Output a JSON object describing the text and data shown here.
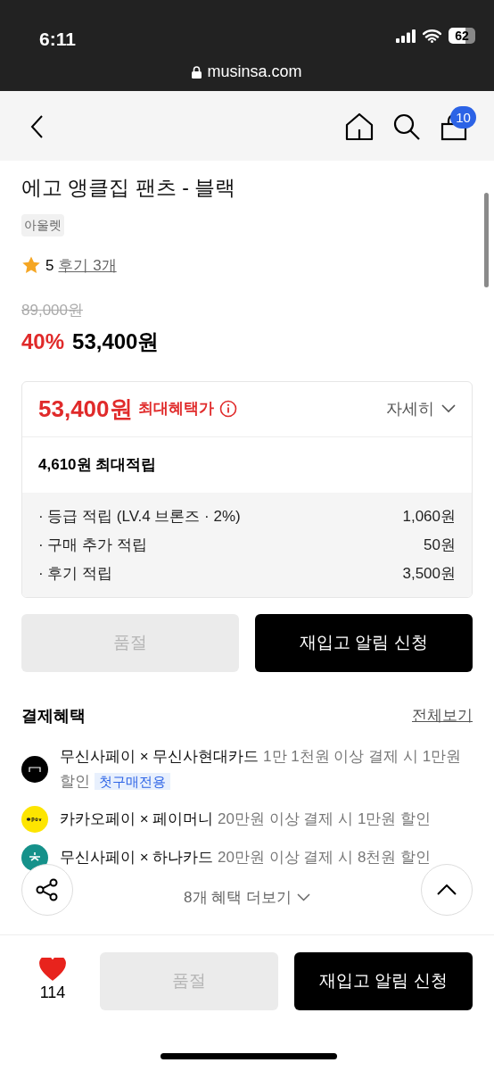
{
  "status_bar": {
    "time": "6:11",
    "battery": "62"
  },
  "address_bar": {
    "url": "musinsa.com"
  },
  "nav": {
    "cart_count": "10"
  },
  "product": {
    "title": "에고 앵클집 팬츠 - 블랙",
    "tag": "아울렛",
    "rating": "5",
    "reviews": "후기 3개",
    "original_price": "89,000원",
    "discount": "40%",
    "price": "53,400원"
  },
  "benefit_card": {
    "price": "53,400원",
    "label": "최대혜택가",
    "details": "자세히",
    "expanded": false,
    "points_total": "4,610원 최대적립",
    "points": [
      {
        "label": "· 등급 적립 (LV.4 브론즈 · 2%)",
        "value": "1,060원"
      },
      {
        "label": "· 구매 추가 적립",
        "value": "50원"
      },
      {
        "label": "· 후기 적립",
        "value": "3,500원"
      }
    ]
  },
  "actions": [
    {
      "label": "품절",
      "disabled": true
    },
    {
      "label": "재입고 알림 신청",
      "disabled": false
    }
  ],
  "payment_benefits": {
    "title": "결제혜택",
    "view_all": "전체보기",
    "items": [
      {
        "kind": "musinsa",
        "title": "무신사페이 × 무신사현대카드",
        "condition": "1만 1천원 이상 결제 시 1만원 할인",
        "badge": "첫구매전용"
      },
      {
        "kind": "kakao",
        "title": "카카오페이 × 페이머니",
        "condition": "20만원 이상 결제 시 1만원 할인"
      },
      {
        "kind": "hana",
        "title": "무신사페이 × 하나카드",
        "condition": "20만원 이상 결제 시 8천원 할인"
      }
    ],
    "more": "8개 혜택 더보기"
  },
  "bottom_bar": {
    "liked": true,
    "like_count": "114",
    "actions": [
      {
        "label": "품절",
        "disabled": true
      },
      {
        "label": "재입고 알림 신청",
        "disabled": false
      }
    ]
  }
}
